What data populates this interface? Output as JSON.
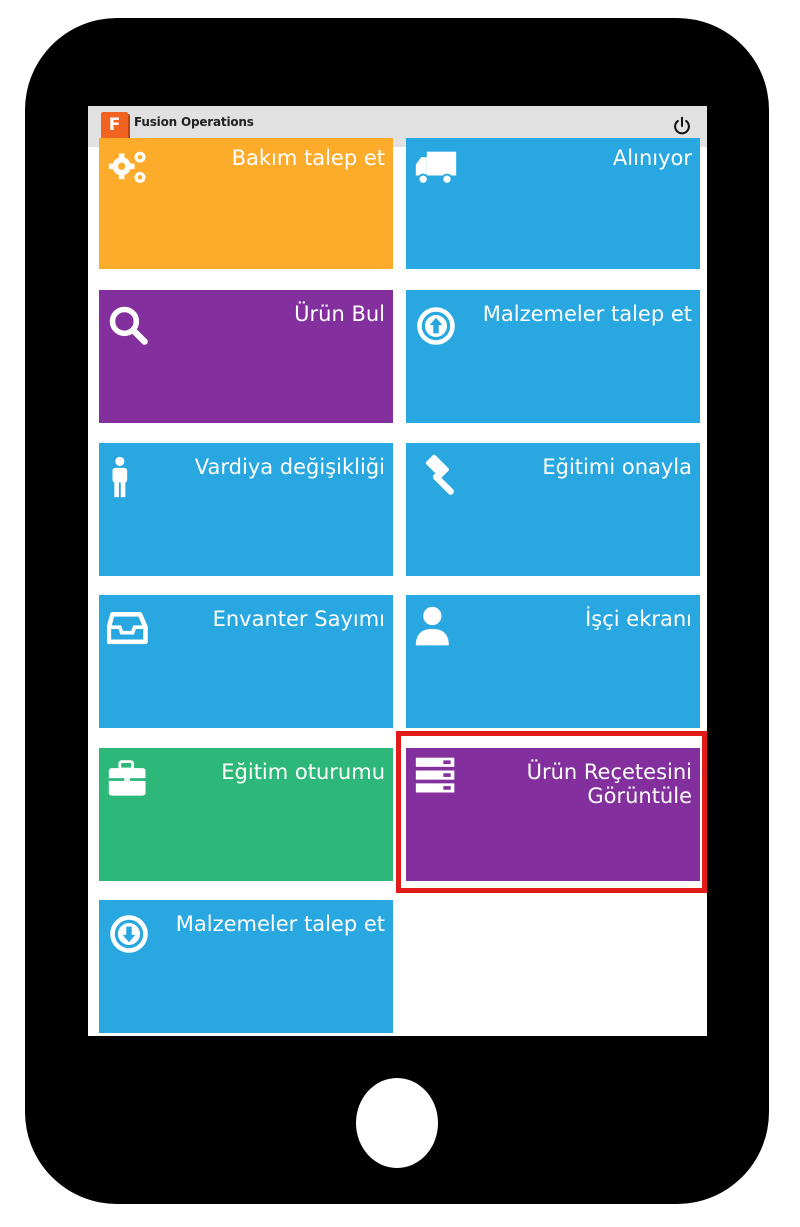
{
  "app": {
    "title": "Fusion Operations",
    "logo_letter": "F",
    "power_icon": "power-icon"
  },
  "colors": {
    "orange": "#fcab2a",
    "blue": "#28a7e1",
    "purple": "#832f9d",
    "green": "#2db87a",
    "highlight": "#e31a1a"
  },
  "tiles": [
    {
      "label": "Bakım talep et",
      "icon": "gears-icon",
      "color": "orange"
    },
    {
      "label": "Alınıyor",
      "icon": "truck-icon",
      "color": "blue"
    },
    {
      "label": "Ürün Bul",
      "icon": "search-icon",
      "color": "purple"
    },
    {
      "label": "Malzemeler talep et",
      "icon": "arrow-up-circle-icon",
      "color": "blue"
    },
    {
      "label": "Vardiya değişikliği",
      "icon": "person-icon",
      "color": "blue"
    },
    {
      "label": "Eğitimi onayla",
      "icon": "gavel-icon",
      "color": "blue"
    },
    {
      "label": "Envanter Sayımı",
      "icon": "inbox-tray-icon",
      "color": "blue"
    },
    {
      "label": "İşçi ekranı",
      "icon": "user-icon",
      "color": "blue"
    },
    {
      "label": "Eğitim oturumu",
      "icon": "briefcase-icon",
      "color": "green"
    },
    {
      "label_line1": "Ürün Reçetesini",
      "label_line2": "Görüntüle",
      "icon": "server-list-icon",
      "color": "purple",
      "highlighted": true
    },
    {
      "label": "Malzemeler talep et",
      "icon": "arrow-down-circle-icon",
      "color": "blue"
    }
  ]
}
